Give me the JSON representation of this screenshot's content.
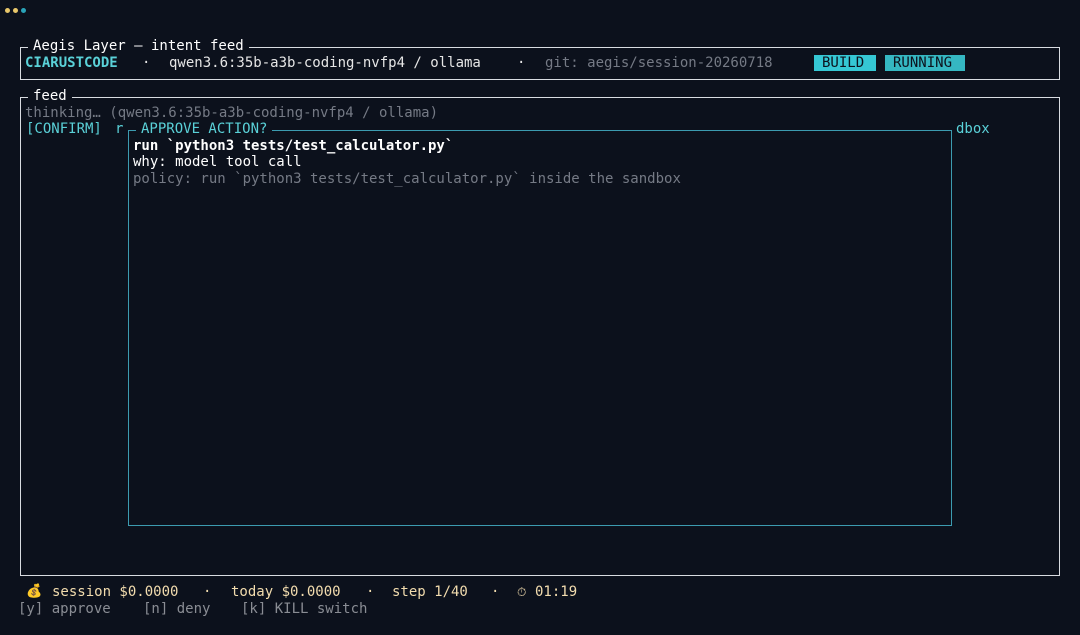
{
  "colors": {
    "background": "#0c111c",
    "border": "#d9dce1",
    "accent": "#5ad1d8",
    "modal_border": "#3c9bb0",
    "badge_build": "#35c7d4",
    "badge_running": "#35b7c2",
    "footer": "#f2dcae",
    "muted": "#757a85"
  },
  "header": {
    "title": "Aegis Layer — intent feed",
    "brand": "CIARUSTCODE",
    "sep": "·",
    "model": "qwen3.6:35b-a3b-coding-nvfp4 / ollama",
    "git": "git: aegis/session-20260718",
    "badges": {
      "build": "BUILD",
      "running": "RUNNING"
    }
  },
  "feed": {
    "title": "feed",
    "thinking": "thinking… (qwen3.6:35b-a3b-coding-nvfp4 / ollama)",
    "confirm_tag": "[CONFIRM]",
    "confirm_frag_left": "r",
    "confirm_frag_right": "dbox"
  },
  "modal": {
    "title": "APPROVE ACTION?",
    "command": "run `python3 tests/test_calculator.py`",
    "why": "why: model tool call",
    "policy": "policy: run `python3 tests/test_calculator.py` inside the sandbox"
  },
  "status": {
    "money_icon": "money-bag-icon",
    "money_glyph": "💰",
    "session": "session $0.0000",
    "sep": "·",
    "today": "today $0.0000",
    "step": "step 1/40",
    "timer_glyph": "⏱",
    "timer": "01:19"
  },
  "keys": {
    "approve": "[y] approve",
    "deny": "[n] deny",
    "kill": "[k] KILL switch"
  }
}
